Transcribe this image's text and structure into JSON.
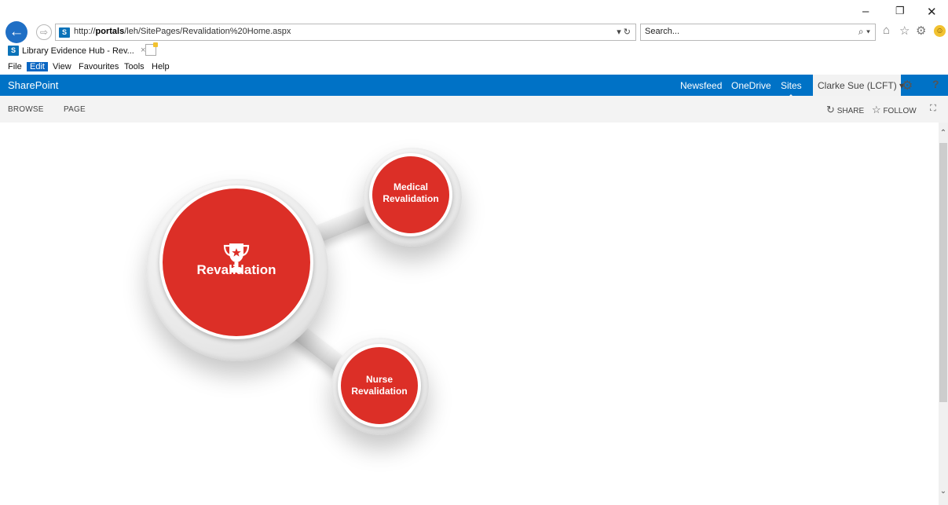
{
  "browser": {
    "address_url_prefix": "http://",
    "address_url_host": "portals",
    "address_url_path": "/leh/SitePages/Revalidation%20Home.aspx",
    "address_controls": "▾ ↻",
    "search_placeholder": "Search...",
    "search_controls": "⌕ ▾",
    "tab_title": "Library Evidence Hub - Rev...",
    "tab_close": "×",
    "window_controls": [
      "–",
      "❐",
      "✕"
    ],
    "toolbar_icons": [
      "home-icon",
      "favorites-star-icon",
      "settings-gear-icon",
      "smiley-feedback-icon"
    ],
    "favicon_text": "S"
  },
  "menubar": {
    "items": [
      "File",
      "Edit",
      "View",
      "Favourites",
      "Tools",
      "Help"
    ],
    "active": "Edit"
  },
  "suitebar": {
    "brand": "SharePoint",
    "links": [
      "Newsfeed",
      "OneDrive",
      "Sites"
    ],
    "current": "Sites",
    "user": "Clarke Sue (LCFT) ▾",
    "gear_glyph": "⚙",
    "help_glyph": "?",
    "color": "#0072c6"
  },
  "ribbon": {
    "tabs": [
      "BROWSE",
      "PAGE"
    ],
    "share_label": "SHARE",
    "follow_label": "FOLLOW",
    "share_glyph": "↻",
    "follow_glyph": "☆",
    "focus_glyph": "⛶"
  },
  "diagram": {
    "accent_color": "#dc2f27",
    "main_label": "Revalidation",
    "main_icon": "trophy-icon",
    "medical_line1": "Medical",
    "medical_line2": "Revalidation",
    "nurse_line1": "Nurse",
    "nurse_line2": "Revalidation"
  },
  "scrollbar": {
    "up_glyph": "⌃",
    "down_glyph": "⌄"
  }
}
